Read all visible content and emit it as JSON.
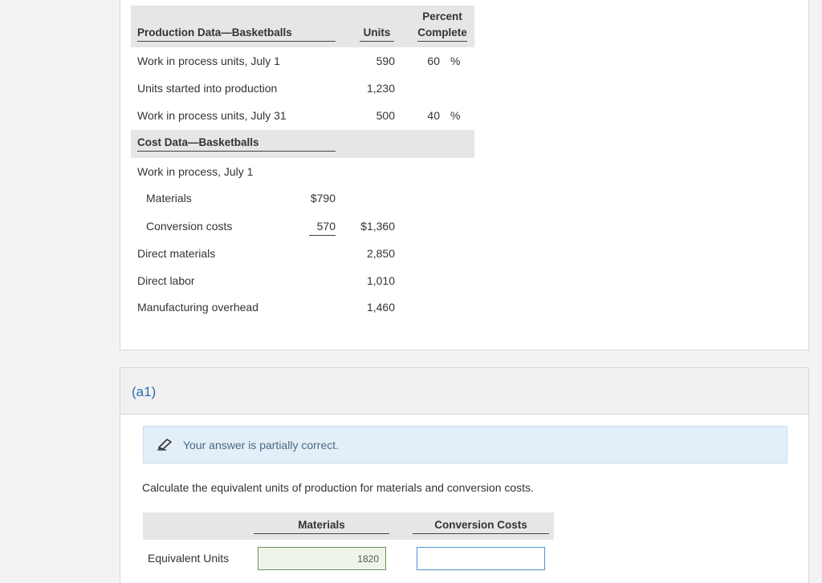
{
  "production": {
    "header_label": "Production Data—Basketballs",
    "col_units": "Units",
    "col_percent_line1": "Percent",
    "col_percent_line2": "Complete",
    "rows": [
      {
        "label": "Work in process units, July 1",
        "units": "590",
        "pct": "60",
        "pct_sym": "%"
      },
      {
        "label": "Units started into production",
        "units": "1,230",
        "pct": "",
        "pct_sym": ""
      },
      {
        "label": "Work in process units, July 31",
        "units": "500",
        "pct": "40",
        "pct_sym": "%"
      }
    ]
  },
  "cost": {
    "header_label": "Cost Data—Basketballs",
    "wip_label": "Work in process, July 1",
    "materials_label": "Materials",
    "materials_value": "$790",
    "conversion_label": "Conversion costs",
    "conversion_value": "570",
    "wip_total": "$1,360",
    "direct_materials_label": "Direct materials",
    "direct_materials_value": "2,850",
    "direct_labor_label": "Direct labor",
    "direct_labor_value": "1,010",
    "overhead_label": "Manufacturing overhead",
    "overhead_value": "1,460"
  },
  "a1": {
    "label": "(a1)",
    "notice": "Your answer is partially correct.",
    "instruction": "Calculate the equivalent units of production for materials and conversion costs.",
    "col_materials": "Materials",
    "col_conversion": "Conversion Costs",
    "row_label": "Equivalent Units",
    "materials_value": "1820",
    "conversion_value": ""
  },
  "colors": {
    "header_band": "#e6e6e6",
    "notice_bg": "#e2eef8",
    "correct_border": "#6f8f5a",
    "focus_border": "#4a90d9",
    "section_label": "#2b6cb0"
  }
}
